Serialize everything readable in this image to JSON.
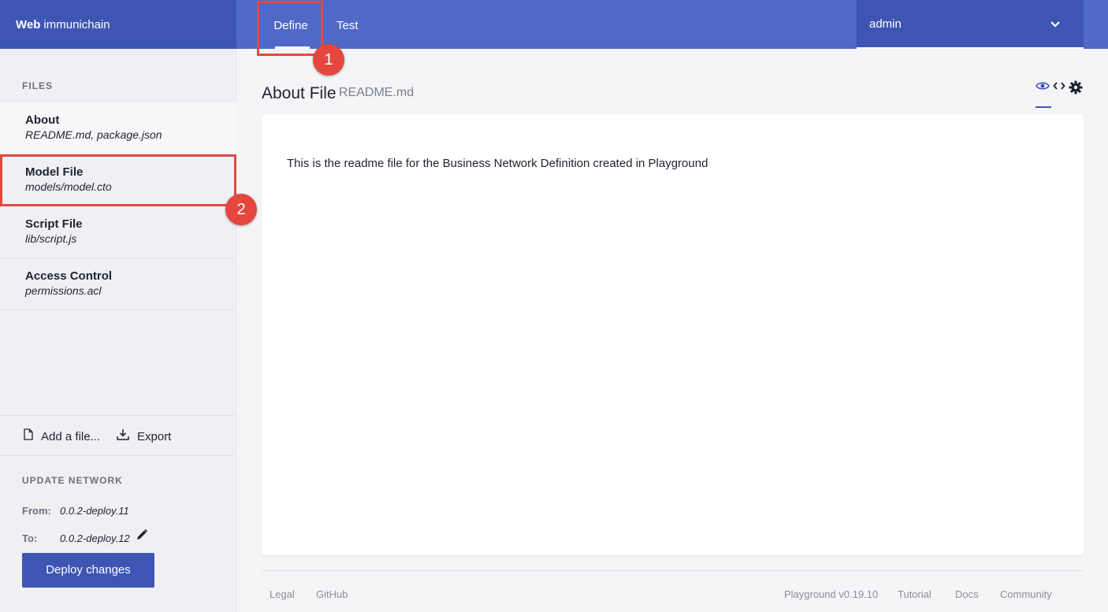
{
  "topbar": {
    "brand_bold": "Web",
    "brand_name": "immunichain",
    "tabs": [
      {
        "label": "Define"
      },
      {
        "label": "Test"
      }
    ],
    "user": "admin"
  },
  "sidebar": {
    "files_title": "FILES",
    "files": [
      {
        "title": "About",
        "subtitle": "README.md, package.json"
      },
      {
        "title": "Model File",
        "subtitle": "models/model.cto"
      },
      {
        "title": "Script File",
        "subtitle": "lib/script.js"
      },
      {
        "title": "Access Control",
        "subtitle": "permissions.acl"
      }
    ],
    "add_file_label": "Add a file...",
    "export_label": "Export",
    "update_title": "UPDATE NETWORK",
    "from_label": "From:",
    "from_value": "0.0.2-deploy.11",
    "to_label": "To:",
    "to_value": "0.0.2-deploy.12",
    "deploy_label": "Deploy changes"
  },
  "main": {
    "title": "About File",
    "subtitle": "README.md",
    "content": "This is the readme file for the Business Network Definition created in Playground"
  },
  "footer": {
    "legal": "Legal",
    "github": "GitHub",
    "version": "Playground v0.19.10",
    "tutorial": "Tutorial",
    "docs": "Docs",
    "community": "Community"
  },
  "annotations": {
    "badge1": "1",
    "badge2": "2"
  },
  "colors": {
    "topbar": "#5068c6",
    "brand_bg": "#3e55b4",
    "highlight": "#e5473f"
  }
}
